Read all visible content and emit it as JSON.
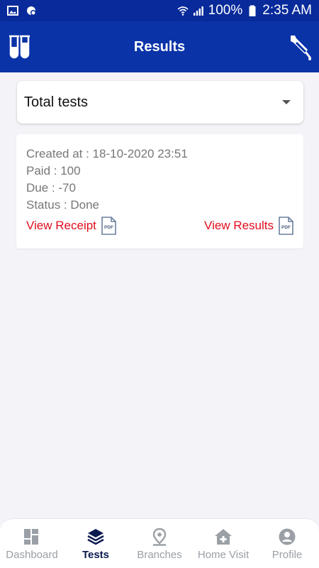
{
  "status_bar": {
    "battery": "100%",
    "time": "2:35 AM"
  },
  "header": {
    "title": "Results",
    "left_icon": "test-tubes-icon",
    "right_icon": "dropper-icon"
  },
  "filter": {
    "selected": "Total tests"
  },
  "result_card": {
    "created_at": "Created at : 18-10-2020 23:51",
    "paid": "Paid : 100",
    "due": "Due : -70",
    "status": "Status : Done",
    "receipt_label": "View Receipt",
    "results_label": "View Results",
    "pdf_text": "PDF"
  },
  "bottom_nav": {
    "items": [
      {
        "label": "Dashboard",
        "icon": "dashboard-icon"
      },
      {
        "label": "Tests",
        "icon": "layers-icon"
      },
      {
        "label": "Branches",
        "icon": "location-pin-icon"
      },
      {
        "label": "Home Visit",
        "icon": "home-plus-icon"
      },
      {
        "label": "Profile",
        "icon": "profile-icon"
      }
    ],
    "active_index": 1
  },
  "colors": {
    "primary": "#0a33a8",
    "link": "#e00e1c",
    "background": "#f3f3f8"
  }
}
